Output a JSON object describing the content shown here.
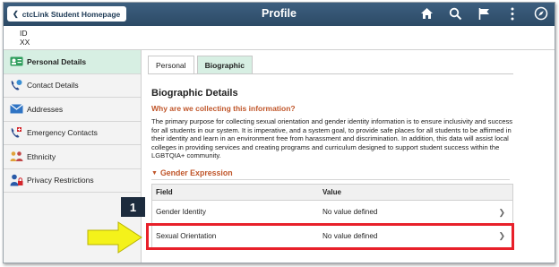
{
  "header": {
    "back_label": "ctcLink Student Homepage",
    "title": "Profile",
    "icons": [
      "home-icon",
      "search-icon",
      "flag-icon",
      "menu-icon",
      "compass-icon"
    ]
  },
  "id_strip": {
    "label": "ID",
    "value": "XX"
  },
  "sidebar": {
    "items": [
      {
        "label": "Personal Details",
        "icon": "id-card-icon",
        "active": true
      },
      {
        "label": "Contact Details",
        "icon": "phone-icon",
        "active": false
      },
      {
        "label": "Addresses",
        "icon": "envelope-icon",
        "active": false
      },
      {
        "label": "Emergency Contacts",
        "icon": "emergency-phone-icon",
        "active": false
      },
      {
        "label": "Ethnicity",
        "icon": "people-icon",
        "active": false
      },
      {
        "label": "Privacy Restrictions",
        "icon": "person-lock-icon",
        "active": false
      }
    ]
  },
  "tabs": [
    {
      "label": "Personal",
      "active": false
    },
    {
      "label": "Biographic",
      "active": true
    }
  ],
  "main": {
    "section_title": "Biographic Details",
    "why_link": "Why are we collecting this information?",
    "body_text": "The primary purpose for collecting sexual orientation and gender identity information is to ensure inclusivity and success for all students in our system. It is imperative, and a system goal, to provide safe places for all students to be affirmed in their identity and learn in an environment free from harassment and discrimination. In addition, this data will assist local colleges in providing services and creating programs and curriculum designed to support student success within the LGBTQIA+ community.",
    "gender_expression_label": "Gender Expression",
    "grid": {
      "columns": [
        "Field",
        "Value"
      ],
      "rows": [
        {
          "field": "Gender Identity",
          "value": "No value defined"
        },
        {
          "field": "Sexual Orientation",
          "value": "No value defined"
        }
      ]
    }
  },
  "annotation": {
    "step_number": "1"
  },
  "colors": {
    "header": "#2c4a66",
    "active_bg": "#d7efe3",
    "link": "#c0562a",
    "highlight": "#e8202a",
    "arrow": "#f4f21a"
  }
}
